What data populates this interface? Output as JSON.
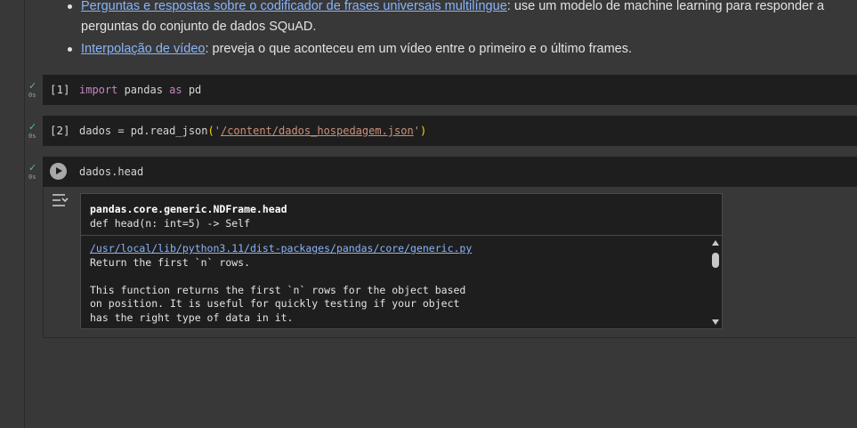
{
  "text_cell": {
    "items": [
      {
        "link": "Perguntas e respostas sobre o codificador de frases universais multilíngue",
        "text": ": use um modelo de machine learning para responder a perguntas do conjunto de dados SQuAD."
      },
      {
        "link": "Interpolação de vídeo",
        "text": ": preveja o que aconteceu em um vídeo entre o primeiro e o último frames."
      }
    ]
  },
  "cells": [
    {
      "count": "[1]",
      "status_time": "0s",
      "code": {
        "kw1": "import",
        "mod": " pandas ",
        "kw2": "as",
        "alias": " pd"
      }
    },
    {
      "count": "[2]",
      "status_time": "0s",
      "code": {
        "prefix": "dados = pd.read_json",
        "open": "(",
        "q1": "'",
        "path": "/content/dados_hospedagem.json",
        "q2": "'",
        "close": ")"
      }
    },
    {
      "status_time": "0s",
      "code": {
        "text": "dados.head"
      }
    }
  ],
  "output": {
    "doc_name": "pandas.core.generic.NDFrame.head",
    "doc_signature": "def head(n: int=5) -> Self",
    "doc_path": "/usr/local/lib/python3.11/dist-packages/pandas/core/generic.py",
    "doc_lines": [
      "Return the first `n` rows.",
      "",
      "This function returns the first `n` rows for the object based",
      "on position. It is useful for quickly testing if your object",
      "has the right type of data in it."
    ]
  },
  "icons": {
    "status": "check-icon",
    "run": "play-icon",
    "output": "output-menu-icon"
  },
  "colors": {
    "background": "#383838",
    "code_bg": "#1e1e1e",
    "link": "#8ab4f8",
    "keyword": "#c586c0",
    "string": "#ce9178",
    "check": "#5bb974"
  }
}
